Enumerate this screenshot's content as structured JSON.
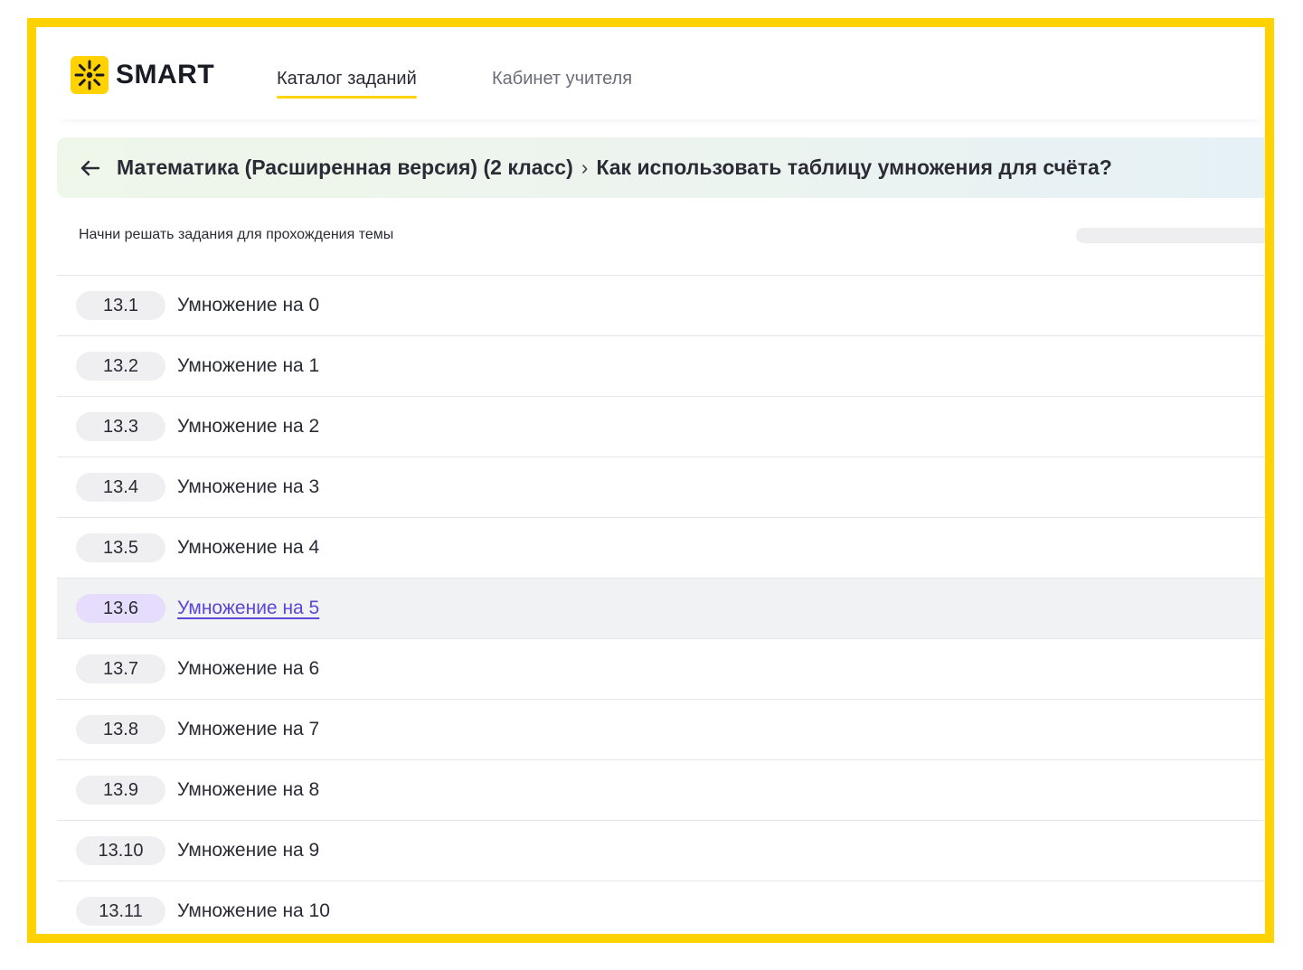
{
  "header": {
    "logo_text": "SMART",
    "nav": [
      {
        "label": "Каталог заданий",
        "active": true
      },
      {
        "label": "Кабинет учителя",
        "active": false
      }
    ]
  },
  "breadcrumb": {
    "subject": "Математика (Расширенная версия) (2 класс)",
    "separator": "›",
    "topic": "Как использовать таблицу умножения для счёта?"
  },
  "hint": "Начни решать задания для прохождения темы",
  "progress": {
    "fraction": 0
  },
  "tasks": [
    {
      "num": "13.1",
      "title": "Умножение на 0"
    },
    {
      "num": "13.2",
      "title": "Умножение на 1"
    },
    {
      "num": "13.3",
      "title": "Умножение на 2"
    },
    {
      "num": "13.4",
      "title": "Умножение на 3"
    },
    {
      "num": "13.5",
      "title": "Умножение на 4"
    },
    {
      "num": "13.6",
      "title": "Умножение на 5"
    },
    {
      "num": "13.7",
      "title": "Умножение на 6"
    },
    {
      "num": "13.8",
      "title": "Умножение на 7"
    },
    {
      "num": "13.9",
      "title": "Умножение на 8"
    },
    {
      "num": "13.10",
      "title": "Умножение на 9"
    },
    {
      "num": "13.11",
      "title": "Умножение на 10"
    }
  ],
  "selected_task": "13.6",
  "colors": {
    "frame": "#ffd200",
    "accent_link": "#5b46d8",
    "selected_badge": "#e6dcfb",
    "badge": "#efeff1"
  },
  "icons": {
    "logo": "sun-icon",
    "back": "arrow-left-icon"
  }
}
